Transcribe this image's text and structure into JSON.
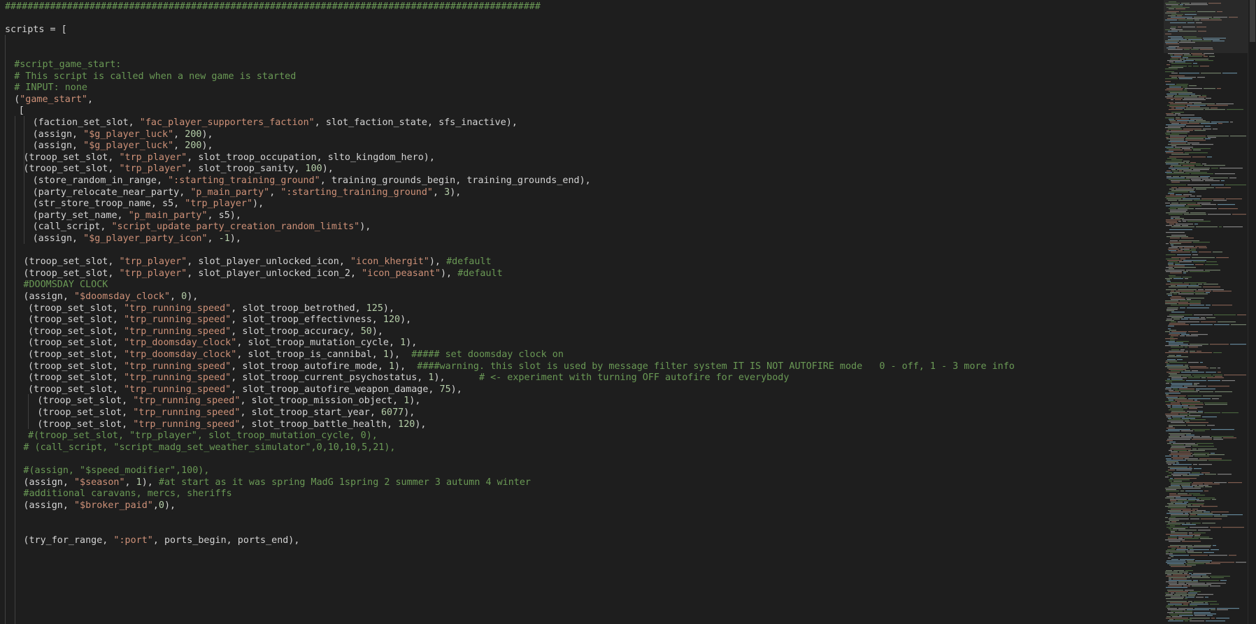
{
  "editor": {
    "colors": {
      "background": "#1e1e1e",
      "foreground": "#d4d4d4",
      "string": "#ce9178",
      "number": "#b5cea8",
      "comment": "#6a9955",
      "header": "#6a9955"
    },
    "lines": [
      {
        "row": 0,
        "indent": 0,
        "tokens": [
          {
            "t": "hdr",
            "v": "###############################################################################################"
          }
        ]
      },
      {
        "row": 2,
        "indent": 0,
        "tokens": [
          {
            "t": "plain",
            "v": "scripts = ["
          }
        ]
      },
      {
        "row": 5,
        "indent": 2,
        "tokens": [
          {
            "t": "cmt",
            "v": "#script_game_start:"
          }
        ]
      },
      {
        "row": 6,
        "indent": 2,
        "tokens": [
          {
            "t": "cmt",
            "v": "# This script is called when a new game is started"
          }
        ]
      },
      {
        "row": 7,
        "indent": 2,
        "tokens": [
          {
            "t": "cmt",
            "v": "# INPUT: none"
          }
        ]
      },
      {
        "row": 8,
        "indent": 2,
        "tokens": [
          {
            "t": "plain",
            "v": "("
          },
          {
            "t": "str",
            "v": "\"game_start\""
          },
          {
            "t": "plain",
            "v": ","
          }
        ]
      },
      {
        "row": 9,
        "indent": 3,
        "tokens": [
          {
            "t": "plain",
            "v": "["
          }
        ]
      },
      {
        "row": 10,
        "indent": 6,
        "tokens": [
          {
            "t": "plain",
            "v": "(faction_set_slot, "
          },
          {
            "t": "str",
            "v": "\"fac_player_supporters_faction\""
          },
          {
            "t": "plain",
            "v": ", slot_faction_state, sfs_inactive),"
          }
        ]
      },
      {
        "row": 11,
        "indent": 6,
        "tokens": [
          {
            "t": "plain",
            "v": "(assign, "
          },
          {
            "t": "str",
            "v": "\"$g_player_luck\""
          },
          {
            "t": "plain",
            "v": ", "
          },
          {
            "t": "num",
            "v": "200"
          },
          {
            "t": "plain",
            "v": "),"
          }
        ]
      },
      {
        "row": 12,
        "indent": 6,
        "tokens": [
          {
            "t": "plain",
            "v": "(assign, "
          },
          {
            "t": "str",
            "v": "\"$g_player_luck\""
          },
          {
            "t": "plain",
            "v": ", "
          },
          {
            "t": "num",
            "v": "200"
          },
          {
            "t": "plain",
            "v": "),"
          }
        ]
      },
      {
        "row": 13,
        "indent": 4,
        "tokens": [
          {
            "t": "plain",
            "v": "(troop_set_slot, "
          },
          {
            "t": "str",
            "v": "\"trp_player\""
          },
          {
            "t": "plain",
            "v": ", slot_troop_occupation, slto_kingdom_hero),"
          }
        ]
      },
      {
        "row": 14,
        "indent": 4,
        "tokens": [
          {
            "t": "plain",
            "v": "(troop_set_slot, "
          },
          {
            "t": "str",
            "v": "\"trp_player\""
          },
          {
            "t": "plain",
            "v": ", slot_troop_sanity, "
          },
          {
            "t": "num",
            "v": "100"
          },
          {
            "t": "plain",
            "v": "),"
          }
        ]
      },
      {
        "row": 15,
        "indent": 6,
        "tokens": [
          {
            "t": "plain",
            "v": "(store_random_in_range, "
          },
          {
            "t": "str",
            "v": "\":starting_training_ground\""
          },
          {
            "t": "plain",
            "v": ", training_grounds_begin, training_grounds_end),"
          }
        ]
      },
      {
        "row": 16,
        "indent": 6,
        "tokens": [
          {
            "t": "plain",
            "v": "(party_relocate_near_party, "
          },
          {
            "t": "str",
            "v": "\"p_main_party\""
          },
          {
            "t": "plain",
            "v": ", "
          },
          {
            "t": "str",
            "v": "\":starting_training_ground\""
          },
          {
            "t": "plain",
            "v": ", "
          },
          {
            "t": "num",
            "v": "3"
          },
          {
            "t": "plain",
            "v": "),"
          }
        ]
      },
      {
        "row": 17,
        "indent": 6,
        "tokens": [
          {
            "t": "plain",
            "v": "(str_store_troop_name, s5, "
          },
          {
            "t": "str",
            "v": "\"trp_player\""
          },
          {
            "t": "plain",
            "v": "),"
          }
        ]
      },
      {
        "row": 18,
        "indent": 6,
        "tokens": [
          {
            "t": "plain",
            "v": "(party_set_name, "
          },
          {
            "t": "str",
            "v": "\"p_main_party\""
          },
          {
            "t": "plain",
            "v": ", s5),"
          }
        ]
      },
      {
        "row": 19,
        "indent": 6,
        "tokens": [
          {
            "t": "plain",
            "v": "(call_script, "
          },
          {
            "t": "str",
            "v": "\"script_update_party_creation_random_limits\""
          },
          {
            "t": "plain",
            "v": "),"
          }
        ]
      },
      {
        "row": 20,
        "indent": 6,
        "tokens": [
          {
            "t": "plain",
            "v": "(assign, "
          },
          {
            "t": "str",
            "v": "\"$g_player_party_icon\""
          },
          {
            "t": "plain",
            "v": ", "
          },
          {
            "t": "num",
            "v": "-1"
          },
          {
            "t": "plain",
            "v": "),"
          }
        ]
      },
      {
        "row": 22,
        "indent": 4,
        "tokens": [
          {
            "t": "plain",
            "v": "(troop_set_slot, "
          },
          {
            "t": "str",
            "v": "\"trp_player\""
          },
          {
            "t": "plain",
            "v": ", slot_player_unlocked_icon, "
          },
          {
            "t": "str",
            "v": "\"icon_khergit\""
          },
          {
            "t": "plain",
            "v": "), "
          },
          {
            "t": "cmt",
            "v": "#default"
          }
        ]
      },
      {
        "row": 23,
        "indent": 4,
        "tokens": [
          {
            "t": "plain",
            "v": "(troop_set_slot, "
          },
          {
            "t": "str",
            "v": "\"trp_player\""
          },
          {
            "t": "plain",
            "v": ", slot_player_unlocked_icon_2, "
          },
          {
            "t": "str",
            "v": "\"icon_peasant\""
          },
          {
            "t": "plain",
            "v": "), "
          },
          {
            "t": "cmt",
            "v": "#default"
          }
        ]
      },
      {
        "row": 24,
        "indent": 4,
        "tokens": [
          {
            "t": "cmt",
            "v": "#DOOMSDAY CLOCK"
          }
        ]
      },
      {
        "row": 25,
        "indent": 4,
        "tokens": [
          {
            "t": "plain",
            "v": "(assign, "
          },
          {
            "t": "str",
            "v": "\"$doomsday_clock\""
          },
          {
            "t": "plain",
            "v": ", "
          },
          {
            "t": "num",
            "v": "0"
          },
          {
            "t": "plain",
            "v": "),"
          }
        ]
      },
      {
        "row": 26,
        "indent": 5,
        "tokens": [
          {
            "t": "plain",
            "v": "(troop_set_slot, "
          },
          {
            "t": "str",
            "v": "\"trp_running_speed\""
          },
          {
            "t": "plain",
            "v": ", slot_troop_betrothed, "
          },
          {
            "t": "num",
            "v": "125"
          },
          {
            "t": "plain",
            "v": "),"
          }
        ]
      },
      {
        "row": 27,
        "indent": 5,
        "tokens": [
          {
            "t": "plain",
            "v": "(troop_set_slot, "
          },
          {
            "t": "str",
            "v": "\"trp_running_speed\""
          },
          {
            "t": "plain",
            "v": ", slot_troop_effectivness, "
          },
          {
            "t": "num",
            "v": "120"
          },
          {
            "t": "plain",
            "v": "),"
          }
        ]
      },
      {
        "row": 28,
        "indent": 5,
        "tokens": [
          {
            "t": "plain",
            "v": "(troop_set_slot, "
          },
          {
            "t": "str",
            "v": "\"trp_running_speed\""
          },
          {
            "t": "plain",
            "v": ", slot_troop_accuracy, "
          },
          {
            "t": "num",
            "v": "50"
          },
          {
            "t": "plain",
            "v": "),"
          }
        ]
      },
      {
        "row": 29,
        "indent": 5,
        "tokens": [
          {
            "t": "plain",
            "v": "(troop_set_slot, "
          },
          {
            "t": "str",
            "v": "\"trp_doomsday_clock\""
          },
          {
            "t": "plain",
            "v": ", slot_troop_mutation_cycle, "
          },
          {
            "t": "num",
            "v": "1"
          },
          {
            "t": "plain",
            "v": "),"
          }
        ]
      },
      {
        "row": 30,
        "indent": 5,
        "tokens": [
          {
            "t": "plain",
            "v": "(troop_set_slot, "
          },
          {
            "t": "str",
            "v": "\"trp_doomsday_clock\""
          },
          {
            "t": "plain",
            "v": ", slot_troop_is_cannibal, "
          },
          {
            "t": "num",
            "v": "1"
          },
          {
            "t": "plain",
            "v": "),  "
          },
          {
            "t": "cmt",
            "v": "##### set doomsday clock on"
          }
        ]
      },
      {
        "row": 31,
        "indent": 5,
        "tokens": [
          {
            "t": "plain",
            "v": "(troop_set_slot, "
          },
          {
            "t": "str",
            "v": "\"trp_running_speed\""
          },
          {
            "t": "plain",
            "v": ", slot_troop_autofire_mode, "
          },
          {
            "t": "num",
            "v": "1"
          },
          {
            "t": "plain",
            "v": "),  "
          },
          {
            "t": "cmt",
            "v": "####warning. this slot is used by message filter system IT IS NOT AUTOFIRE mode   0 - off, 1 - 3 more info"
          }
        ]
      },
      {
        "row": 32,
        "indent": 5,
        "tokens": [
          {
            "t": "plain",
            "v": "(troop_set_slot, "
          },
          {
            "t": "str",
            "v": "\"trp_running_speed\""
          },
          {
            "t": "plain",
            "v": ", slot_troop_current_psychostatus, "
          },
          {
            "t": "num",
            "v": "1"
          },
          {
            "t": "plain",
            "v": "),      "
          },
          {
            "t": "cmt",
            "v": "# <- experiment with turning OFF autofire for everybody"
          }
        ]
      },
      {
        "row": 33,
        "indent": 5,
        "tokens": [
          {
            "t": "plain",
            "v": "(troop_set_slot, "
          },
          {
            "t": "str",
            "v": "\"trp_running_speed\""
          },
          {
            "t": "plain",
            "v": ", slot_troop_autofire_weapon_damage, "
          },
          {
            "t": "num",
            "v": "75"
          },
          {
            "t": "plain",
            "v": "),"
          }
        ]
      },
      {
        "row": 34,
        "indent": 7,
        "tokens": [
          {
            "t": "plain",
            "v": "(troop_set_slot, "
          },
          {
            "t": "str",
            "v": "\"trp_running_speed\""
          },
          {
            "t": "plain",
            "v": ", slot_troop_mission_object, "
          },
          {
            "t": "num",
            "v": "1"
          },
          {
            "t": "plain",
            "v": "),"
          }
        ]
      },
      {
        "row": 35,
        "indent": 7,
        "tokens": [
          {
            "t": "plain",
            "v": "(troop_set_slot, "
          },
          {
            "t": "str",
            "v": "\"trp_running_speed\""
          },
          {
            "t": "plain",
            "v": ", slot_troop_start_year, "
          },
          {
            "t": "num",
            "v": "6077"
          },
          {
            "t": "plain",
            "v": "),"
          }
        ]
      },
      {
        "row": 36,
        "indent": 7,
        "tokens": [
          {
            "t": "plain",
            "v": "(troop_set_slot, "
          },
          {
            "t": "str",
            "v": "\"trp_running_speed\""
          },
          {
            "t": "plain",
            "v": ", slot_troop_battle_health, "
          },
          {
            "t": "num",
            "v": "120"
          },
          {
            "t": "plain",
            "v": "),"
          }
        ]
      },
      {
        "row": 37,
        "indent": 5,
        "tokens": [
          {
            "t": "cmt",
            "v": "#(troop_set_slot, \"trp_player\", slot_troop_mutation_cycle, 0),"
          }
        ]
      },
      {
        "row": 38,
        "indent": 4,
        "tokens": [
          {
            "t": "cmt",
            "v": "# (call_script, \"script_madg_set_weather_simulator\",0,10,10,5,21),"
          }
        ]
      },
      {
        "row": 40,
        "indent": 4,
        "tokens": [
          {
            "t": "cmt",
            "v": "#(assign, \"$speed_modifier\",100),"
          }
        ]
      },
      {
        "row": 41,
        "indent": 4,
        "tokens": [
          {
            "t": "plain",
            "v": "(assign, "
          },
          {
            "t": "str",
            "v": "\"$season\""
          },
          {
            "t": "plain",
            "v": ", "
          },
          {
            "t": "num",
            "v": "1"
          },
          {
            "t": "plain",
            "v": "), "
          },
          {
            "t": "cmt",
            "v": "#at start as it was spring MadG 1spring 2 summer 3 autumn 4 winter"
          }
        ]
      },
      {
        "row": 42,
        "indent": 4,
        "tokens": [
          {
            "t": "cmt",
            "v": "#additional caravans, mercs, sheriffs"
          }
        ]
      },
      {
        "row": 43,
        "indent": 4,
        "tokens": [
          {
            "t": "plain",
            "v": "(assign, "
          },
          {
            "t": "str",
            "v": "\"$broker_paid\""
          },
          {
            "t": "plain",
            "v": ","
          },
          {
            "t": "num",
            "v": "0"
          },
          {
            "t": "plain",
            "v": "),"
          }
        ]
      },
      {
        "row": 46,
        "indent": 4,
        "tokens": [
          {
            "t": "plain",
            "v": "(try_for_range, "
          },
          {
            "t": "str",
            "v": "\":port\""
          },
          {
            "t": "plain",
            "v": ", ports_begin, ports_end),"
          }
        ]
      }
    ]
  }
}
